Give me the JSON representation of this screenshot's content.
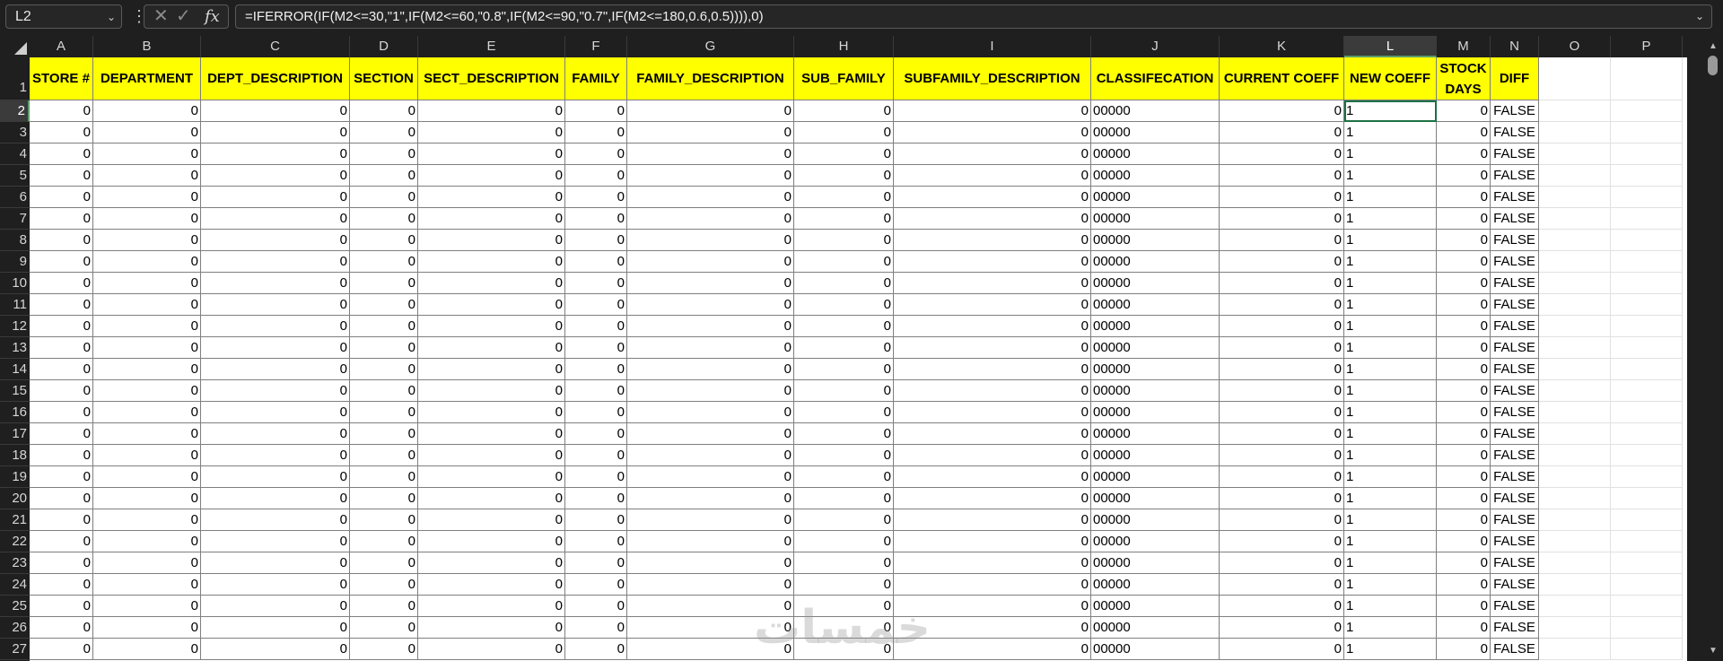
{
  "formula_bar": {
    "name_box": "L2",
    "formula": "=IFERROR(IF(M2<=30,\"1\",IF(M2<=60,\"0.8\",IF(M2<=90,\"0.7\",IF(M2<=180,0.6,0.5)))),0)",
    "fx_label": "fx"
  },
  "columns": [
    {
      "letter": "A",
      "header": "STORE #",
      "value": "0",
      "align": "num"
    },
    {
      "letter": "B",
      "header": "DEPARTMENT",
      "value": "0",
      "align": "num"
    },
    {
      "letter": "C",
      "header": "DEPT_DESCRIPTION",
      "value": "0",
      "align": "num"
    },
    {
      "letter": "D",
      "header": "SECTION",
      "value": "0",
      "align": "num"
    },
    {
      "letter": "E",
      "header": "SECT_DESCRIPTION",
      "value": "0",
      "align": "num"
    },
    {
      "letter": "F",
      "header": "FAMILY",
      "value": "0",
      "align": "num"
    },
    {
      "letter": "G",
      "header": "FAMILY_DESCRIPTION",
      "value": "0",
      "align": "num"
    },
    {
      "letter": "H",
      "header": "SUB_FAMILY",
      "value": "0",
      "align": "num"
    },
    {
      "letter": "I",
      "header": "SUBFAMILY_DESCRIPTION",
      "value": "0",
      "align": "num"
    },
    {
      "letter": "J",
      "header": "CLASSIFECATION",
      "value": "00000",
      "align": "txt"
    },
    {
      "letter": "K",
      "header": "CURRENT COEFF",
      "value": "0",
      "align": "num"
    },
    {
      "letter": "L",
      "header": "NEW COEFF",
      "value": "1",
      "align": "txt"
    },
    {
      "letter": "M",
      "header": "STOCK DAYS",
      "value": "0",
      "align": "num"
    },
    {
      "letter": "N",
      "header": "DIFF",
      "value": "FALSE",
      "align": "ctr"
    },
    {
      "letter": "O",
      "header": "",
      "value": "",
      "align": "empty"
    },
    {
      "letter": "P",
      "header": "",
      "value": "",
      "align": "empty"
    }
  ],
  "row_numbers": [
    "1",
    "2",
    "3",
    "4",
    "5",
    "6",
    "7",
    "8",
    "9",
    "10",
    "11",
    "12",
    "13",
    "14",
    "15",
    "16",
    "17",
    "18",
    "19",
    "20",
    "21",
    "22",
    "23",
    "24",
    "25",
    "26",
    "27"
  ],
  "active_cell": {
    "column": "L",
    "row": "2"
  },
  "watermark": "خمسات"
}
